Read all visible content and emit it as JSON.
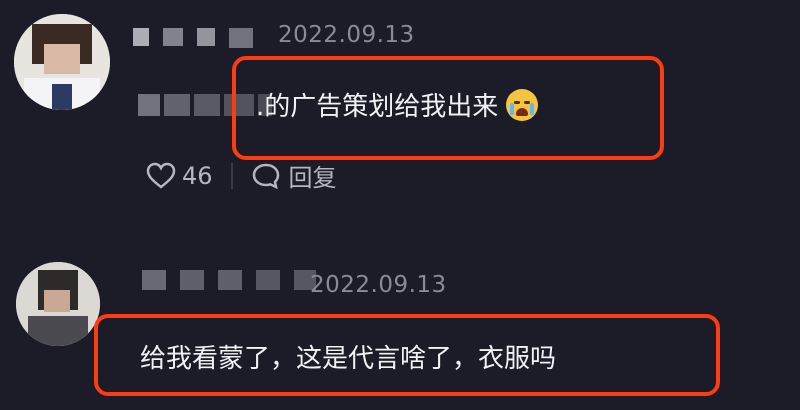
{
  "comments": [
    {
      "date": "2022.09.13",
      "text_prefix": ".",
      "text": "的广告策划给我出来",
      "emoji": "loudly-crying-face-emoji",
      "like_count": "46",
      "reply_label": "回复"
    },
    {
      "date": "2022.09.13",
      "text": "给我看蒙了，这是代言啥了，衣服吗"
    }
  ],
  "colors": {
    "background": "#1c1c28",
    "highlight_border": "#ff3b12",
    "muted_text": "#8b8b97",
    "main_text": "#f2f2f5"
  },
  "icons": [
    "heart-icon",
    "reply-icon"
  ]
}
